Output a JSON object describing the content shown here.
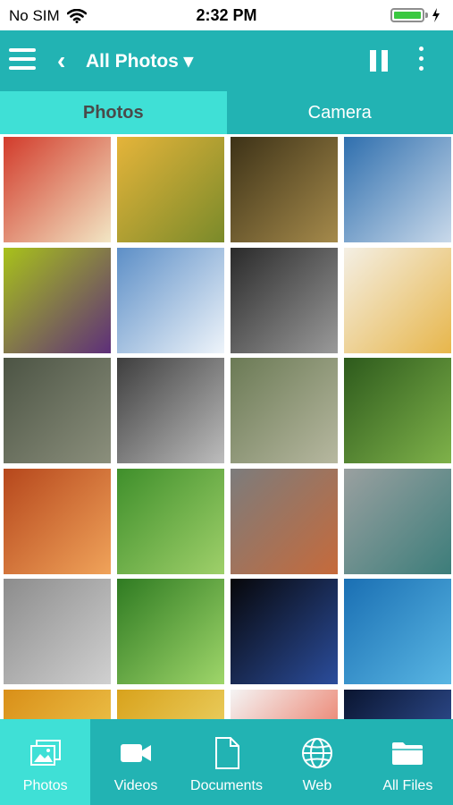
{
  "status": {
    "carrier": "No SIM",
    "time": "2:32 PM"
  },
  "nav": {
    "title": "All Photos ▾"
  },
  "tabs": [
    {
      "label": "Photos",
      "active": true
    },
    {
      "label": "Camera",
      "active": false
    }
  ],
  "thumbnails": [
    {
      "name": "thumb-abstract-portrait",
      "colors": [
        "#d23b2b",
        "#f2e6c4"
      ]
    },
    {
      "name": "thumb-sunflowers",
      "colors": [
        "#e5b43a",
        "#7a8a2a"
      ]
    },
    {
      "name": "thumb-mona-lisa",
      "colors": [
        "#3d3217",
        "#a58a4b"
      ]
    },
    {
      "name": "thumb-fighter-jets",
      "colors": [
        "#2f6fae",
        "#c9d9ea"
      ]
    },
    {
      "name": "thumb-flower-macro",
      "colors": [
        "#a8c21a",
        "#5e2f7a"
      ]
    },
    {
      "name": "thumb-snow-hikers",
      "colors": [
        "#5d8fc7",
        "#eef4fa"
      ]
    },
    {
      "name": "thumb-woman-portrait",
      "colors": [
        "#2a2a2a",
        "#9a9a9a"
      ]
    },
    {
      "name": "thumb-street-map",
      "colors": [
        "#f4efe4",
        "#e7b64b"
      ]
    },
    {
      "name": "thumb-aerial-city",
      "colors": [
        "#4c5444",
        "#8b8f7c"
      ]
    },
    {
      "name": "thumb-sports-car",
      "colors": [
        "#3e3e3e",
        "#bdbdbd"
      ]
    },
    {
      "name": "thumb-aerial-town",
      "colors": [
        "#6b7a55",
        "#b7b8a0"
      ]
    },
    {
      "name": "thumb-grass-dew",
      "colors": [
        "#2d5a1c",
        "#7fb24a"
      ]
    },
    {
      "name": "thumb-sandstone-canyon",
      "colors": [
        "#b6471c",
        "#f0a35a"
      ]
    },
    {
      "name": "thumb-clownfish",
      "colors": [
        "#3f8f2b",
        "#9fd06a"
      ]
    },
    {
      "name": "thumb-man-with-rock",
      "colors": [
        "#7c7c7c",
        "#c66a3b"
      ]
    },
    {
      "name": "thumb-machine-parts",
      "colors": [
        "#9aa0a0",
        "#3c7d7a"
      ]
    },
    {
      "name": "thumb-robot-arm",
      "colors": [
        "#8c8c8c",
        "#d0d0d0"
      ]
    },
    {
      "name": "thumb-water-drop",
      "colors": [
        "#2f7b22",
        "#9fd66a"
      ]
    },
    {
      "name": "thumb-night-tower",
      "colors": [
        "#07070a",
        "#2b4d9c"
      ]
    },
    {
      "name": "thumb-blue-hole",
      "colors": [
        "#1a6fb3",
        "#59b6e3"
      ]
    },
    {
      "name": "thumb-autumn-trees",
      "colors": [
        "#d98f18",
        "#f3d35a"
      ]
    },
    {
      "name": "thumb-tulip-field",
      "colors": [
        "#d8a21c",
        "#f2e07a"
      ]
    },
    {
      "name": "thumb-red-fish",
      "colors": [
        "#f4f4f4",
        "#e8553a"
      ]
    },
    {
      "name": "thumb-space-art",
      "colors": [
        "#0a1530",
        "#3b5fb0"
      ]
    }
  ],
  "bottom_nav": [
    {
      "label": "Photos",
      "icon": "photos-icon",
      "active": true
    },
    {
      "label": "Videos",
      "icon": "video-camera-icon",
      "active": false
    },
    {
      "label": "Documents",
      "icon": "document-icon",
      "active": false
    },
    {
      "label": "Web",
      "icon": "globe-icon",
      "active": false
    },
    {
      "label": "All Files",
      "icon": "folder-icon",
      "active": false
    }
  ]
}
